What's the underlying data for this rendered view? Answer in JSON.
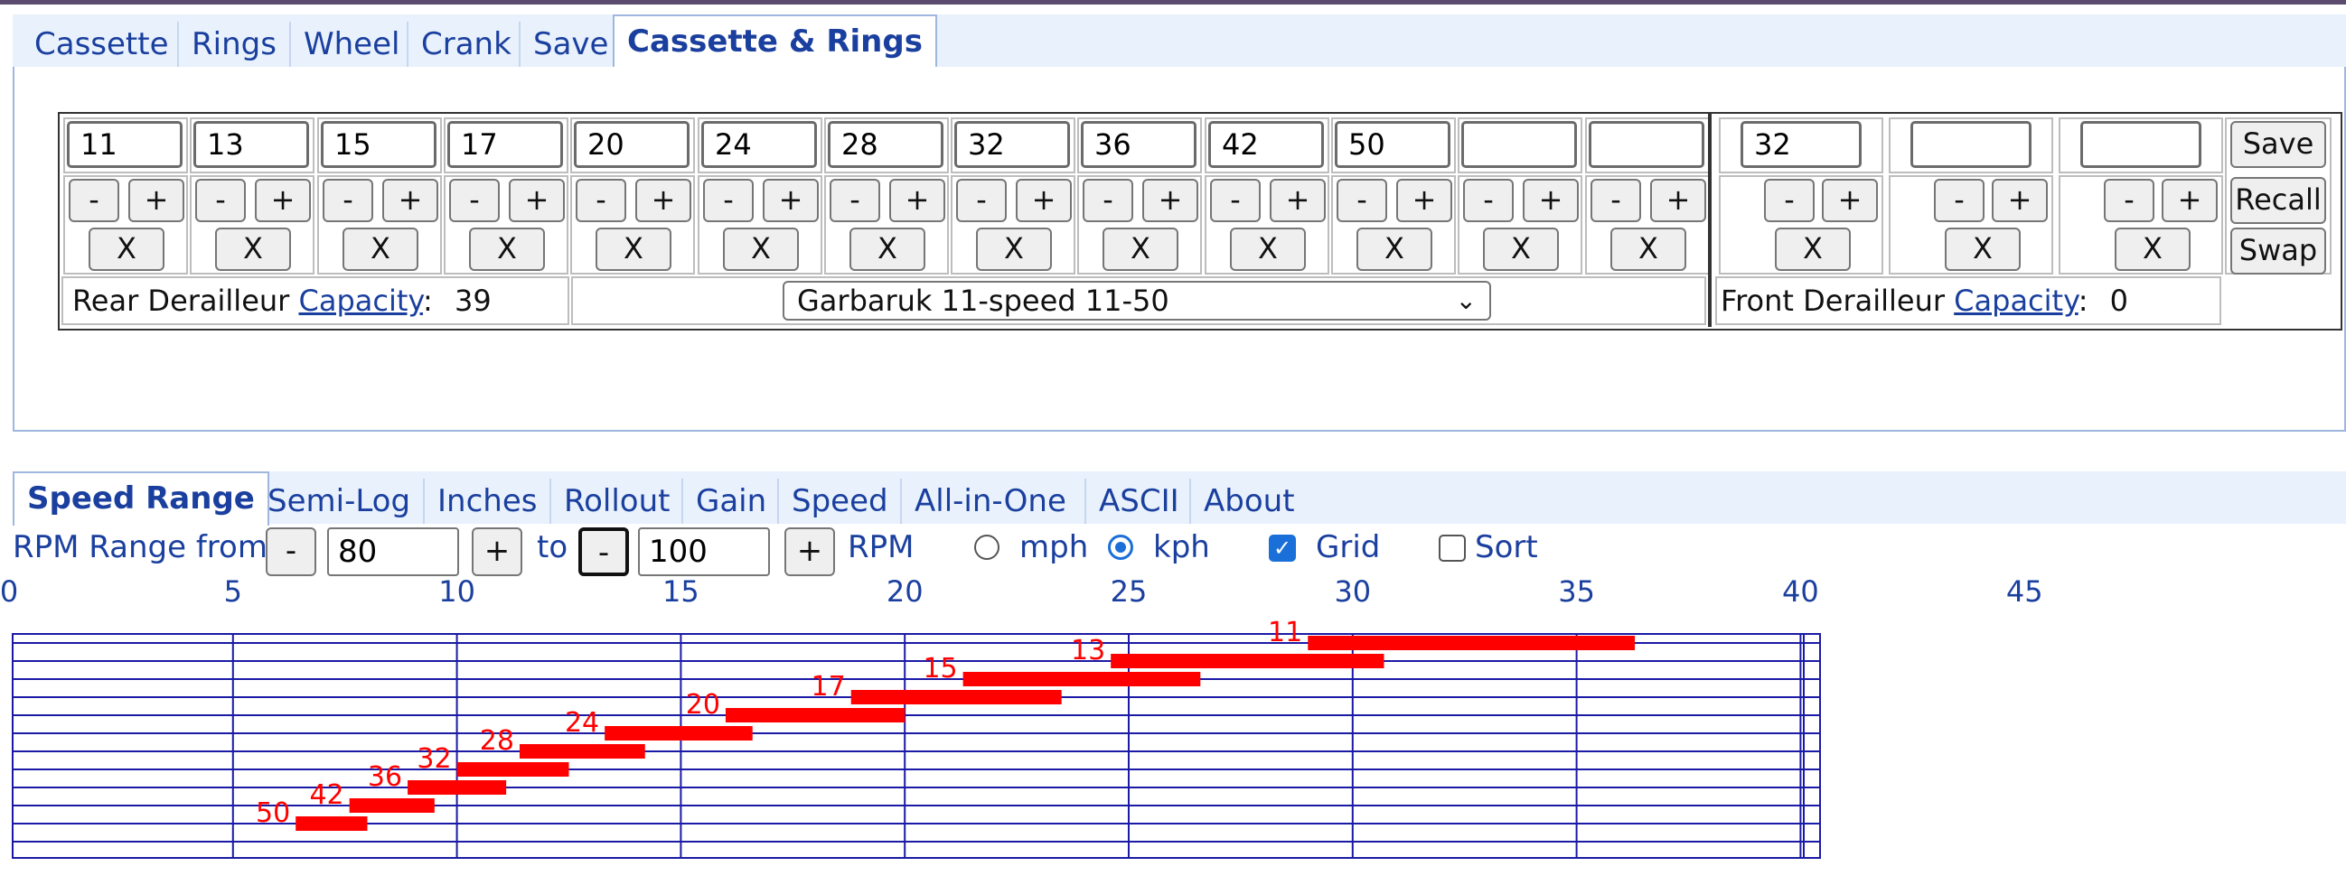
{
  "top_tabs": [
    "Cassette",
    "Rings",
    "Wheel",
    "Crank",
    "Save",
    "Cassette & Rings"
  ],
  "cassette": {
    "cogs": [
      "11",
      "13",
      "15",
      "17",
      "20",
      "24",
      "28",
      "32",
      "36",
      "42",
      "50",
      "",
      ""
    ],
    "minus_label": "-",
    "plus_label": "+",
    "remove_label": "X"
  },
  "rings": {
    "teeth": [
      "32",
      "",
      ""
    ]
  },
  "side_buttons": {
    "save": "Save",
    "recall": "Recall",
    "swap": "Swap"
  },
  "rear_derailleur": {
    "label": "Rear Derailleur",
    "link": "Capacity",
    "sep": ":",
    "value": "39"
  },
  "front_derailleur": {
    "label": "Front Derailleur",
    "link": "Capacity",
    "sep": ":",
    "value": "0"
  },
  "preset_select": {
    "selected": "Garbaruk 11-speed 11-50"
  },
  "bottom_tabs": [
    "Speed Range",
    "Semi-Log",
    "Inches",
    "Rollout",
    "Gain",
    "Speed",
    "All-in-One",
    "ASCII",
    "About"
  ],
  "rpm": {
    "label": "RPM Range from",
    "from": "80",
    "to_label": "to",
    "to": "100",
    "unit_label": "RPM",
    "minus": "-",
    "plus": "+"
  },
  "options": {
    "mph": "mph",
    "kph": "kph",
    "grid": "Grid",
    "sort": "Sort",
    "units_selected": "kph",
    "grid_checked": true,
    "sort_checked": false
  },
  "colors": {
    "tab_text": "#1a3f9e",
    "bar": "#ff0000",
    "grid_line": "#1a1aa6"
  },
  "chart_data": {
    "type": "bar",
    "x_axis": {
      "min": 0,
      "max": 45,
      "ticks": [
        0,
        5,
        10,
        15,
        20,
        25,
        30,
        35,
        40,
        45
      ],
      "grid": true,
      "unit": "kph"
    },
    "series": [
      {
        "label": "11",
        "from": 29.0,
        "to": 36.3
      },
      {
        "label": "13",
        "from": 24.6,
        "to": 30.7
      },
      {
        "label": "15",
        "from": 21.3,
        "to": 26.6
      },
      {
        "label": "17",
        "from": 18.8,
        "to": 23.5
      },
      {
        "label": "20",
        "from": 16.0,
        "to": 20.0
      },
      {
        "label": "24",
        "from": 13.3,
        "to": 16.6
      },
      {
        "label": "28",
        "from": 11.4,
        "to": 14.2
      },
      {
        "label": "32",
        "from": 10.0,
        "to": 12.5
      },
      {
        "label": "36",
        "from": 8.9,
        "to": 11.1
      },
      {
        "label": "42",
        "from": 7.6,
        "to": 9.5
      },
      {
        "label": "50",
        "from": 6.4,
        "to": 8.0
      }
    ]
  }
}
